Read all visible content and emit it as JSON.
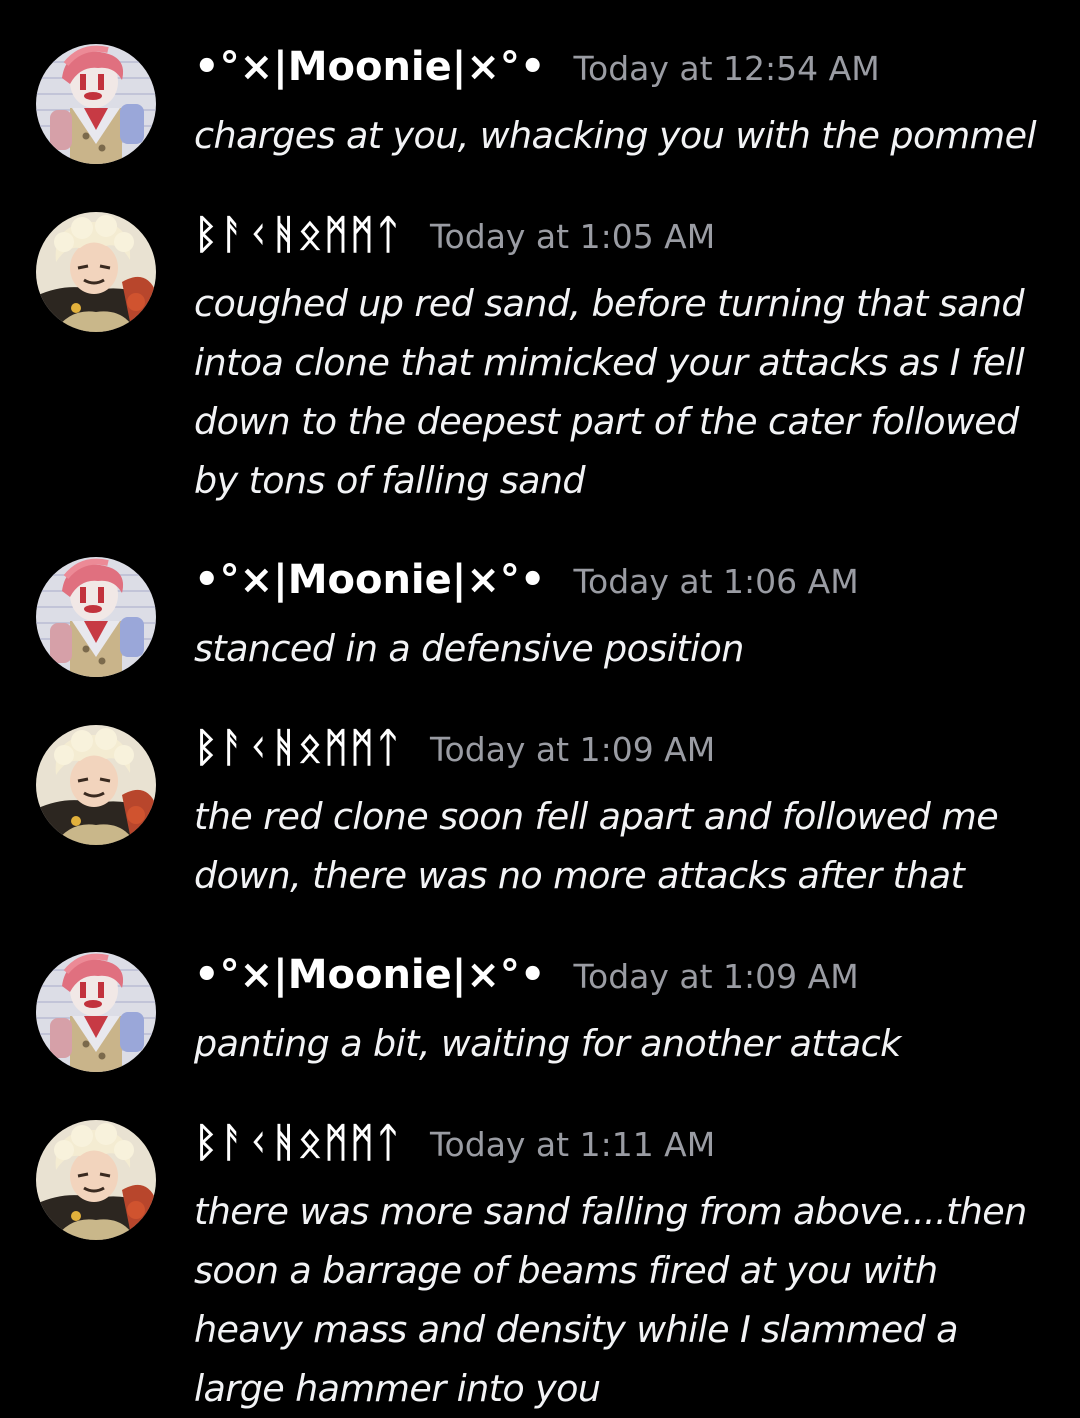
{
  "messages": [
    {
      "author": "•°×|Moonie|×°•",
      "avatar_icon": "clown-avatar-icon",
      "timestamp": "Today at 12:54 AM",
      "lines": [
        "charges at you, whacking you with the pommel"
      ]
    },
    {
      "author": "ᛒᚨᚲᚻᛟᛗᛗᛏ",
      "avatar_icon": "blond-character-avatar-icon",
      "timestamp": "Today at 1:05 AM",
      "lines": [
        "coughed up red sand, before turning that sand",
        "intoa clone that mimicked your attacks as I fell",
        "down to the deepest part of the cater followed",
        "by tons of falling sand"
      ]
    },
    {
      "author": "•°×|Moonie|×°•",
      "avatar_icon": "clown-avatar-icon",
      "timestamp": "Today at 1:06 AM",
      "lines": [
        "stanced in a defensive position"
      ]
    },
    {
      "author": "ᛒᚨᚲᚻᛟᛗᛗᛏ",
      "avatar_icon": "blond-character-avatar-icon",
      "timestamp": "Today at 1:09 AM",
      "lines": [
        "the red clone soon fell apart and followed me",
        "down, there was no more attacks after that"
      ]
    },
    {
      "author": "•°×|Moonie|×°•",
      "avatar_icon": "clown-avatar-icon",
      "timestamp": "Today at 1:09 AM",
      "lines": [
        "panting a bit, waiting for another attack"
      ]
    },
    {
      "author": "ᛒᚨᚲᚻᛟᛗᛗᛏ",
      "avatar_icon": "blond-character-avatar-icon",
      "timestamp": "Today at 1:11 AM",
      "lines": [
        "there was more sand falling from above....then",
        "soon a barrage of beams fired at you with",
        "heavy mass and density while I slammed a",
        "large hammer into you"
      ]
    }
  ],
  "colors": {
    "background": "#000000",
    "username": "#ffffff",
    "timestamp": "#9a9ca3",
    "message_text": "#f2f3f5"
  }
}
